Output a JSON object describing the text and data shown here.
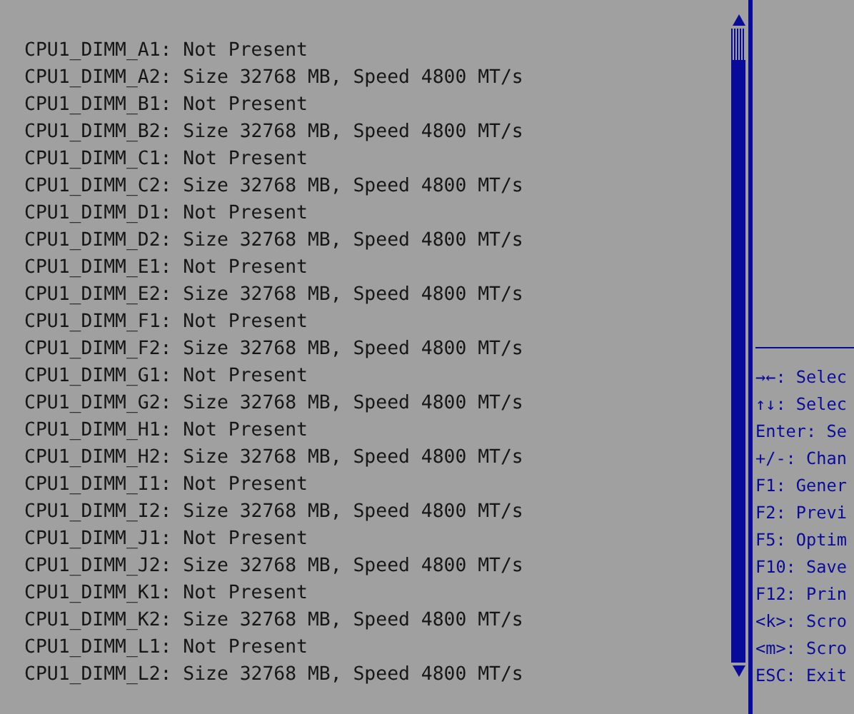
{
  "memory_info": [
    "CPU1_DIMM_A1: Not Present",
    "CPU1_DIMM_A2: Size 32768 MB, Speed 4800 MT/s",
    "CPU1_DIMM_B1: Not Present",
    "CPU1_DIMM_B2: Size 32768 MB, Speed 4800 MT/s",
    "CPU1_DIMM_C1: Not Present",
    "CPU1_DIMM_C2: Size 32768 MB, Speed 4800 MT/s",
    "CPU1_DIMM_D1: Not Present",
    "CPU1_DIMM_D2: Size 32768 MB, Speed 4800 MT/s",
    "CPU1_DIMM_E1: Not Present",
    "CPU1_DIMM_E2: Size 32768 MB, Speed 4800 MT/s",
    "CPU1_DIMM_F1: Not Present",
    "CPU1_DIMM_F2: Size 32768 MB, Speed 4800 MT/s",
    "CPU1_DIMM_G1: Not Present",
    "CPU1_DIMM_G2: Size 32768 MB, Speed 4800 MT/s",
    "CPU1_DIMM_H1: Not Present",
    "CPU1_DIMM_H2: Size 32768 MB, Speed 4800 MT/s",
    "CPU1_DIMM_I1: Not Present",
    "CPU1_DIMM_I2: Size 32768 MB, Speed 4800 MT/s",
    "CPU1_DIMM_J1: Not Present",
    "CPU1_DIMM_J2: Size 32768 MB, Speed 4800 MT/s",
    "CPU1_DIMM_K1: Not Present",
    "CPU1_DIMM_K2: Size 32768 MB, Speed 4800 MT/s",
    "CPU1_DIMM_L1: Not Present",
    "CPU1_DIMM_L2: Size 32768 MB, Speed 4800 MT/s"
  ],
  "help_keys": [
    "→←: Selec",
    "↑↓: Selec",
    "Enter: Se",
    "+/-: Chan",
    "F1: Gener",
    "F2: Previ",
    "F5: Optim",
    "F10: Save",
    "F12: Prin",
    "<k>: Scro",
    "<m>: Scro",
    "ESC: Exit"
  ]
}
